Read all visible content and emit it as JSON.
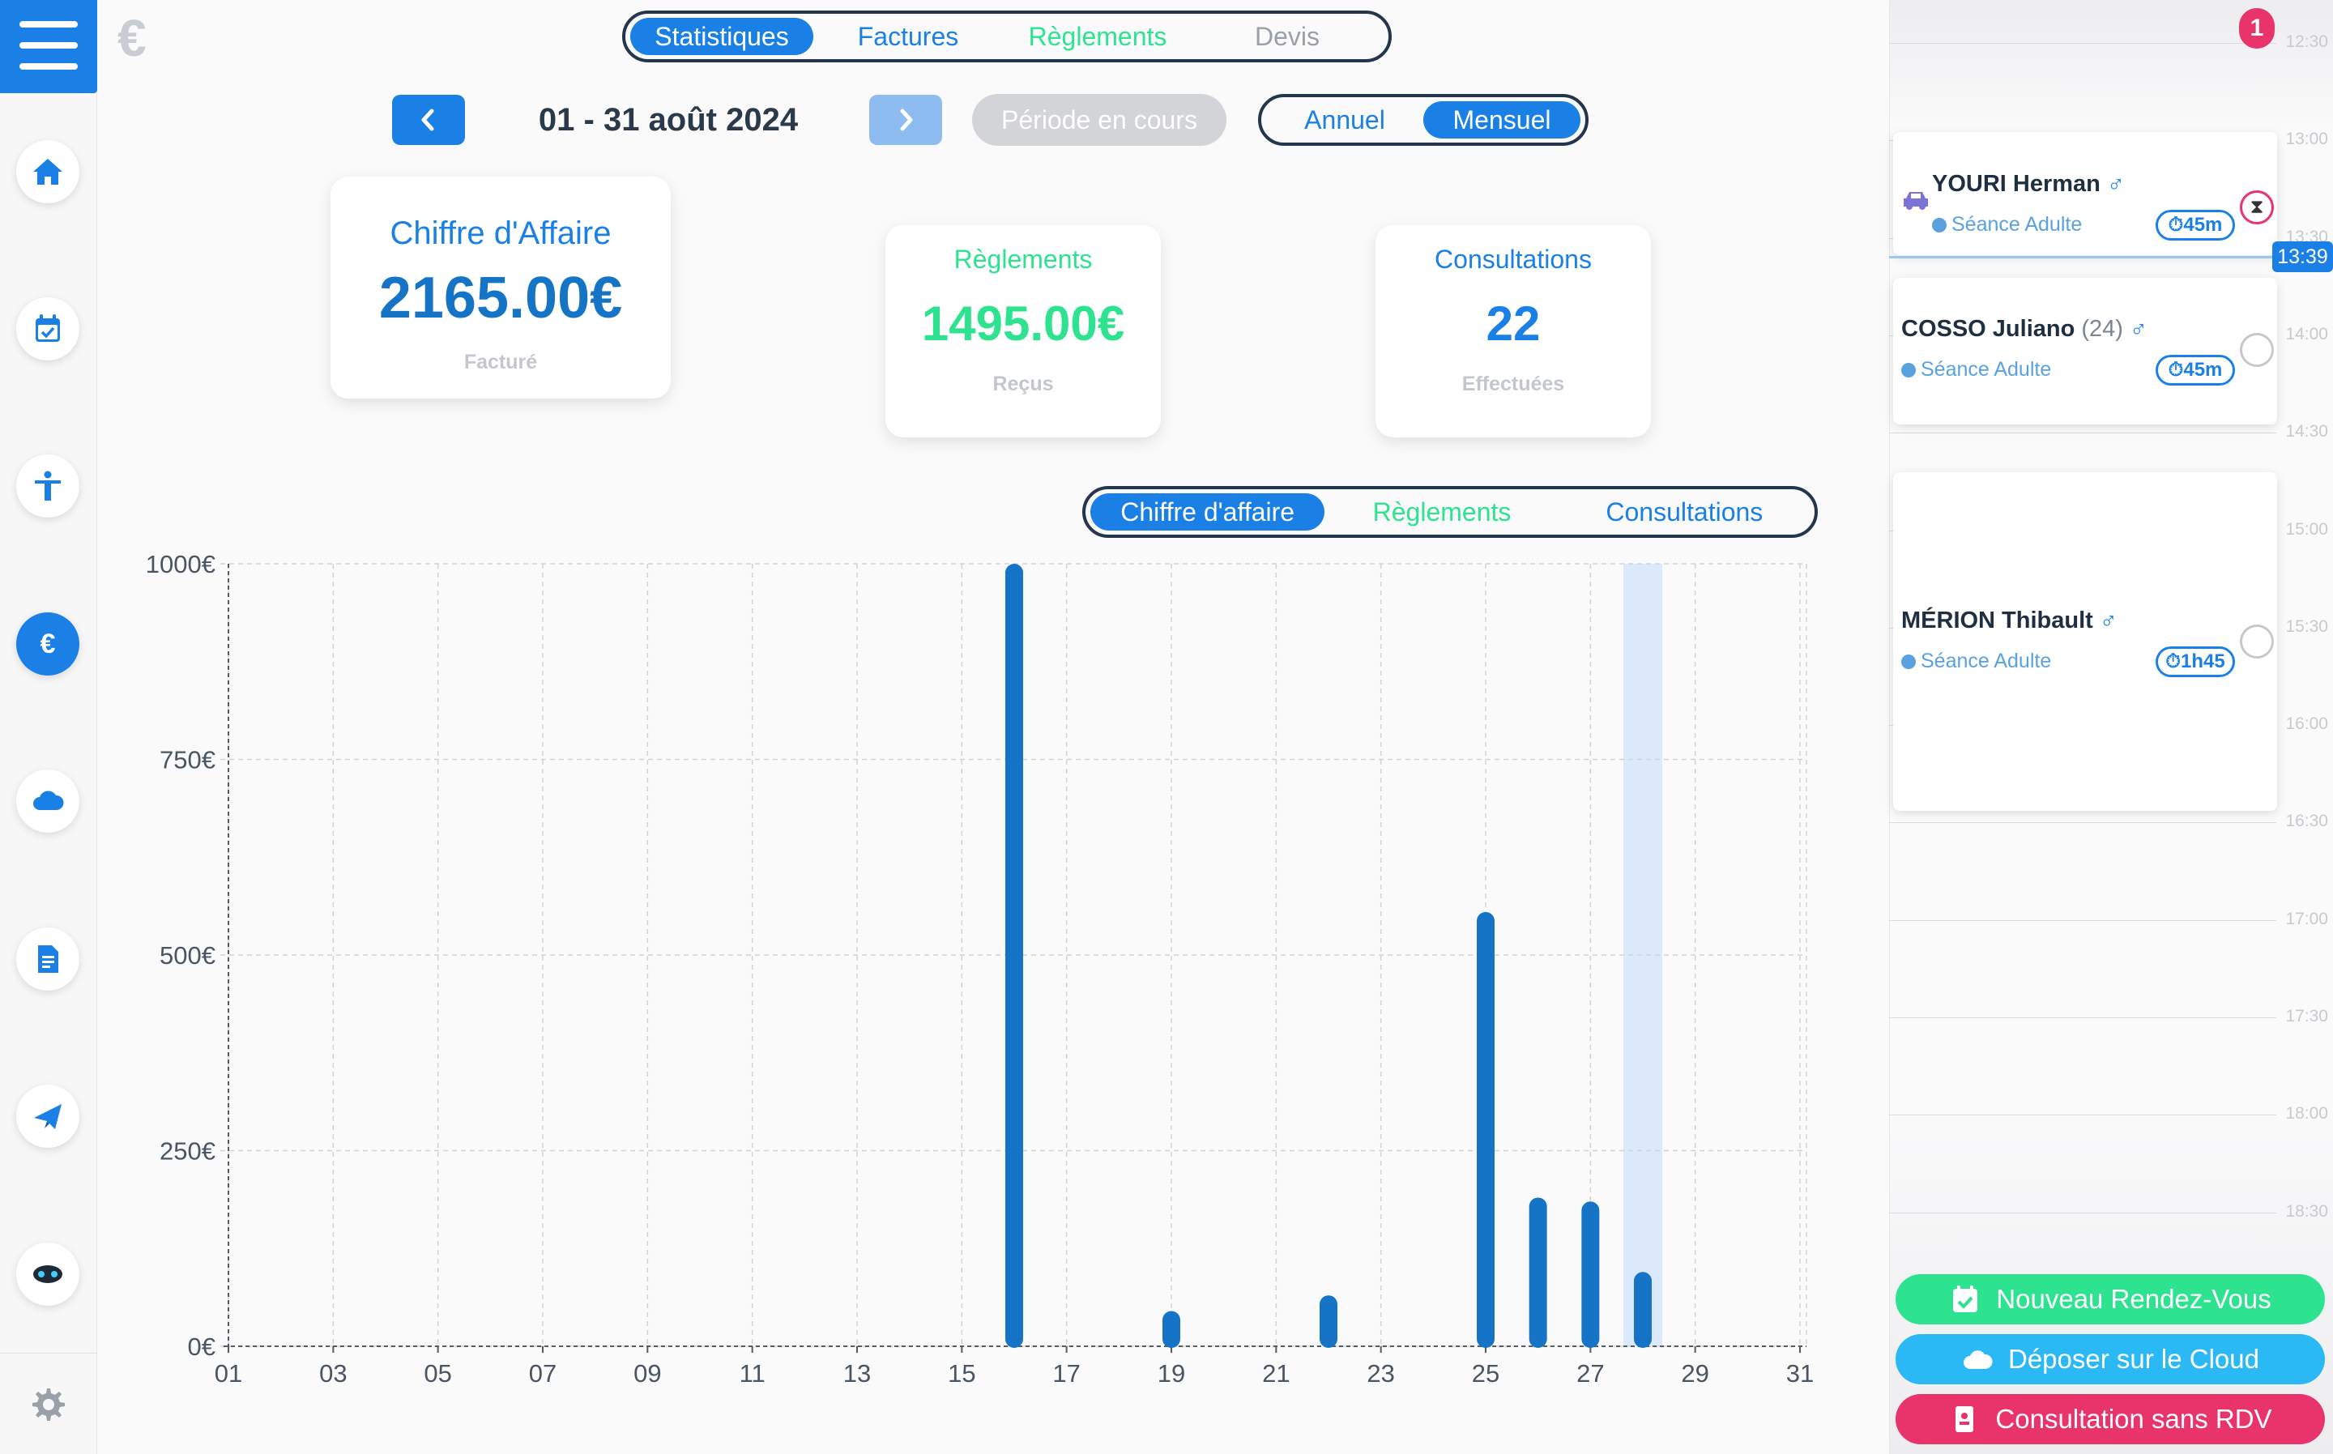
{
  "currency_symbol": "€",
  "tabs": [
    {
      "label": "Statistiques",
      "selected": true
    },
    {
      "label": "Factures",
      "selected": false
    },
    {
      "label": "Règlements",
      "selected": false
    },
    {
      "label": "Devis",
      "selected": false
    }
  ],
  "period": {
    "label": "01 - 31 août 2024",
    "current_button": "Période en cours",
    "modes": [
      {
        "label": "Annuel",
        "selected": false
      },
      {
        "label": "Mensuel",
        "selected": true
      }
    ]
  },
  "kpis": {
    "ca": {
      "title": "Chiffre d'Affaire",
      "value": "2165.00€",
      "sub": "Facturé"
    },
    "reglements": {
      "title": "Règlements",
      "value": "1495.00€",
      "sub": "Reçus"
    },
    "consultations": {
      "title": "Consultations",
      "value": "22",
      "sub": "Effectuées"
    }
  },
  "chart_tabs": [
    {
      "label": "Chiffre d'affaire",
      "selected": true
    },
    {
      "label": "Règlements",
      "selected": false
    },
    {
      "label": "Consultations",
      "selected": false
    }
  ],
  "colors": {
    "primary": "#1a80e5",
    "bar": "#1674c7",
    "green": "#2ee38f",
    "navy": "#23364d",
    "pink": "#e8336b",
    "cyan": "#2bb9f5",
    "highlight": "#dce9fb"
  },
  "chart_data": {
    "type": "bar",
    "x": [
      1,
      2,
      3,
      4,
      5,
      6,
      7,
      8,
      9,
      10,
      11,
      12,
      13,
      14,
      15,
      16,
      17,
      18,
      19,
      20,
      21,
      22,
      23,
      24,
      25,
      26,
      27,
      28,
      29,
      30,
      31
    ],
    "values": [
      0,
      0,
      0,
      0,
      0,
      0,
      0,
      0,
      0,
      0,
      0,
      0,
      0,
      0,
      0,
      1000,
      0,
      0,
      45,
      0,
      0,
      65,
      0,
      0,
      555,
      190,
      185,
      95,
      0,
      0,
      0
    ],
    "highlighted_day": 28,
    "xticks": [
      "01",
      "03",
      "05",
      "07",
      "09",
      "11",
      "13",
      "15",
      "17",
      "19",
      "21",
      "23",
      "25",
      "27",
      "29",
      "31"
    ],
    "yticks": [
      "0€",
      "250€",
      "500€",
      "750€",
      "1000€"
    ],
    "ylim": [
      0,
      1000
    ],
    "grid": true
  },
  "agenda": {
    "notification_count": "1",
    "hours": [
      "12:30",
      "13:00",
      "13:30",
      "14:00",
      "14:30",
      "15:00",
      "15:30",
      "16:00",
      "16:30",
      "17:00",
      "17:30",
      "18:00",
      "18:30"
    ],
    "now": "13:39",
    "appointments": [
      {
        "name": "YOURI Herman",
        "age": "",
        "gender": "♂",
        "type": "Séance Adulte",
        "duration": "45m",
        "status": "waiting"
      },
      {
        "name": "COSSO Juliano",
        "age": "(24)",
        "gender": "♂",
        "type": "Séance Adulte",
        "duration": "45m",
        "status": "empty"
      },
      {
        "name": "MÉRION Thibault",
        "age": "",
        "gender": "♂",
        "type": "Séance Adulte",
        "duration": "1h45",
        "status": "empty"
      }
    ]
  },
  "actions": {
    "new_rdv": "Nouveau Rendez-Vous",
    "cloud": "Déposer sur le Cloud",
    "no_rdv": "Consultation sans RDV"
  },
  "sidebar": {
    "items": [
      "home-icon",
      "calendar-icon",
      "body-icon",
      "euro-icon",
      "cloud-icon",
      "document-icon",
      "send-icon",
      "robot-icon"
    ],
    "active": "euro-icon"
  }
}
